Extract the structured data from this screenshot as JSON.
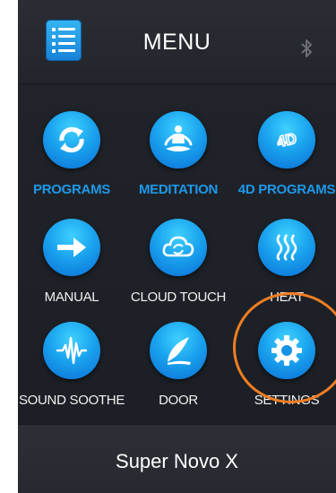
{
  "header": {
    "title": "MENU",
    "menu_icon": "list-menu-icon",
    "status_icon": "bluetooth-icon"
  },
  "menu_items": [
    {
      "label": "PROGRAMS",
      "icon": "sync-arrows-icon"
    },
    {
      "label": "MEDITATION",
      "icon": "meditation-icon"
    },
    {
      "label": "4D PROGRAMS",
      "icon": "4d-icon"
    },
    {
      "label": "MANUAL",
      "icon": "arrow-right-icon"
    },
    {
      "label": "CLOUD TOUCH",
      "icon": "cloud-sync-icon"
    },
    {
      "label": "HEAT",
      "icon": "heat-waves-icon"
    },
    {
      "label": "SOUND SOOTHE",
      "icon": "sound-wave-icon"
    },
    {
      "label": "DOOR",
      "icon": "door-leaf-icon"
    },
    {
      "label": "SETTINGS",
      "icon": "gear-icon"
    }
  ],
  "footer": {
    "device_name": "Super Novo X"
  },
  "colors": {
    "accent": "#1d98e8",
    "highlight": "#f07d22",
    "background": "#1d2026"
  }
}
